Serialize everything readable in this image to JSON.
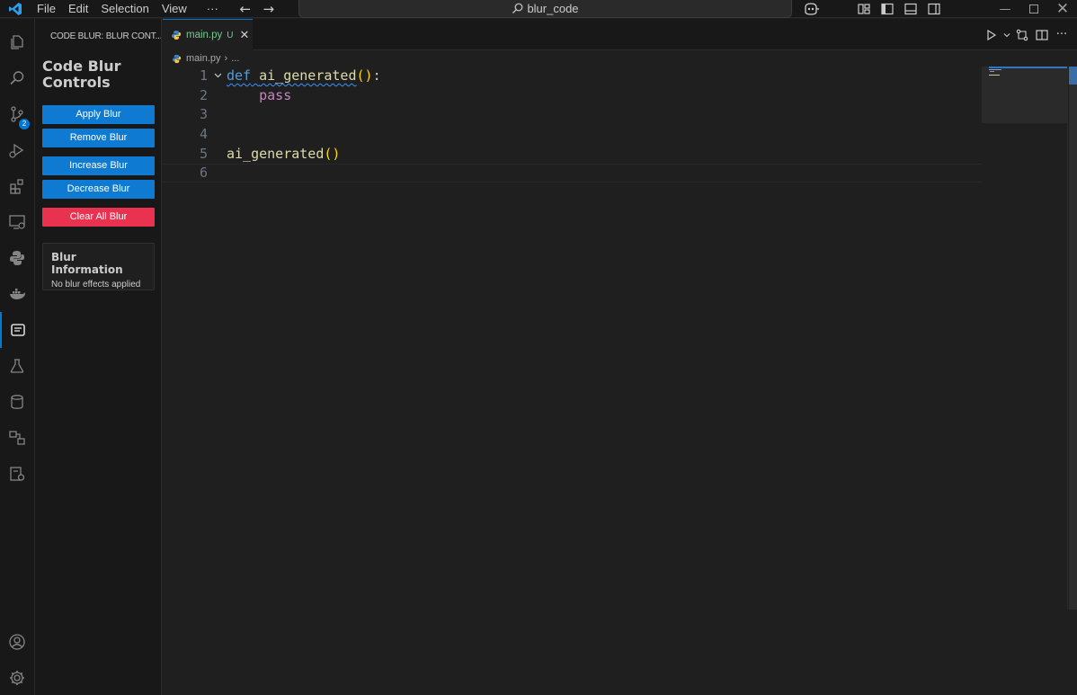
{
  "titlebar": {
    "menus": [
      "File",
      "Edit",
      "Selection",
      "View",
      "···"
    ],
    "search_text": "blur_code"
  },
  "sidebar": {
    "header": "CODE BLUR: BLUR CONT...",
    "panel_title": "Code Blur Controls",
    "buttons": {
      "apply": "Apply Blur",
      "remove": "Remove Blur",
      "increase": "Increase Blur",
      "decrease": "Decrease Blur",
      "clear": "Clear All Blur"
    },
    "info": {
      "title": "Blur Information",
      "text": "No blur effects applied"
    }
  },
  "activity": {
    "source_control_badge": "2"
  },
  "editor": {
    "tab": {
      "label": "main.py",
      "status": "U"
    },
    "breadcrumb": {
      "file": "main.py",
      "more": "..."
    },
    "lines": [
      {
        "n": "1",
        "def": "def",
        "name": "ai_generated",
        "parens": "()",
        "colon": ":"
      },
      {
        "n": "2",
        "text": "pass"
      },
      {
        "n": "3"
      },
      {
        "n": "4"
      },
      {
        "n": "5",
        "name": "ai_generated",
        "parens": "()"
      },
      {
        "n": "6"
      }
    ]
  },
  "colors": {
    "accent": "#0078d4",
    "button_blue": "#0e7ad1",
    "button_red": "#e8324f",
    "modified_green": "#73c991"
  }
}
